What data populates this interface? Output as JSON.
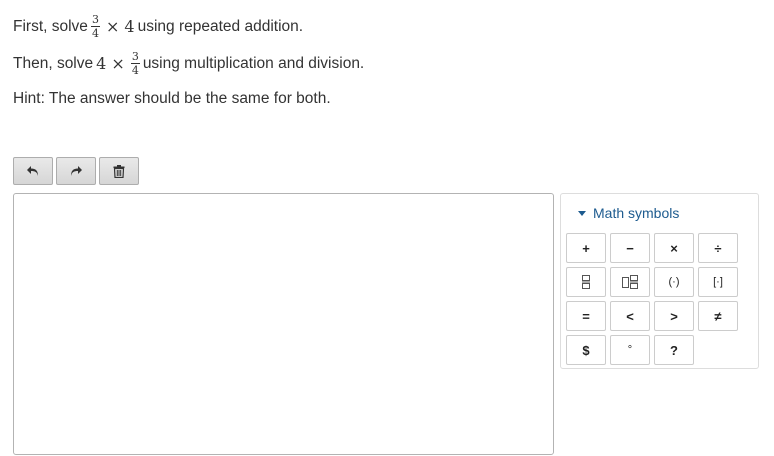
{
  "instructions": {
    "line1": {
      "prefix": "First, solve",
      "frac_num": "3",
      "frac_den": "4",
      "expr": "× 4",
      "suffix": "using repeated addition."
    },
    "line2": {
      "prefix": "Then, solve",
      "expr": "4 ×",
      "frac_num": "3",
      "frac_den": "4",
      "suffix": "using multiplication and division."
    },
    "hint": "Hint: The answer should be the same for both."
  },
  "toolbar": {
    "buttons": [
      "undo-icon",
      "redo-icon",
      "trash-icon"
    ]
  },
  "math_panel": {
    "title": "Math symbols",
    "symbols": {
      "plus": "+",
      "minus": "−",
      "times": "×",
      "divide": "÷",
      "paren": "(·)",
      "bracket": "[·]",
      "equals": "=",
      "less": "<",
      "greater": ">",
      "not_equal": "≠",
      "dollar": "$",
      "degree": "°",
      "question": "?"
    },
    "icons": [
      "fraction-icon",
      "mixed-number-icon"
    ]
  }
}
